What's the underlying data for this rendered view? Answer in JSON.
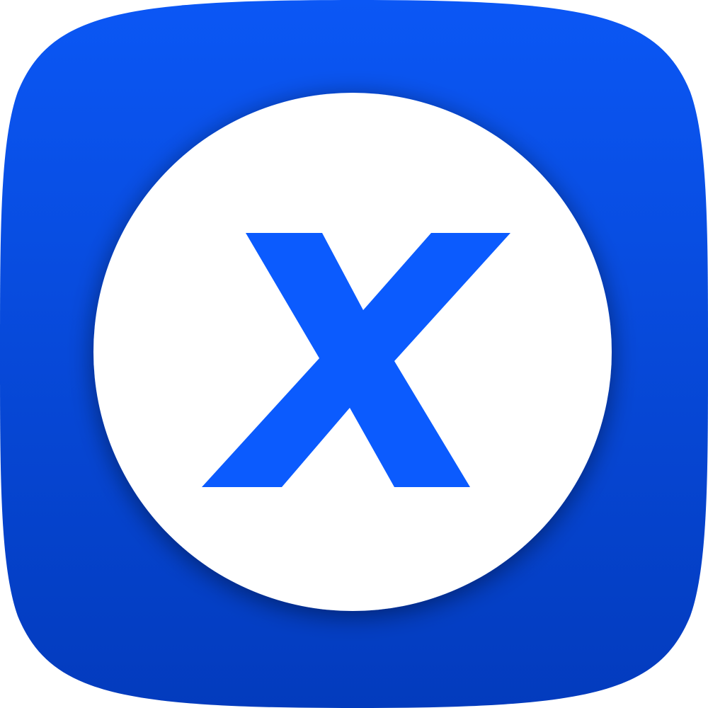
{
  "app_icon": {
    "icon_name": "x-letter-app-icon",
    "letter": "X",
    "colors": {
      "tile_top": "#0b57f5",
      "tile_bottom": "#033bbd",
      "circle": "#ffffff",
      "letter": "#0b5bfe"
    }
  }
}
